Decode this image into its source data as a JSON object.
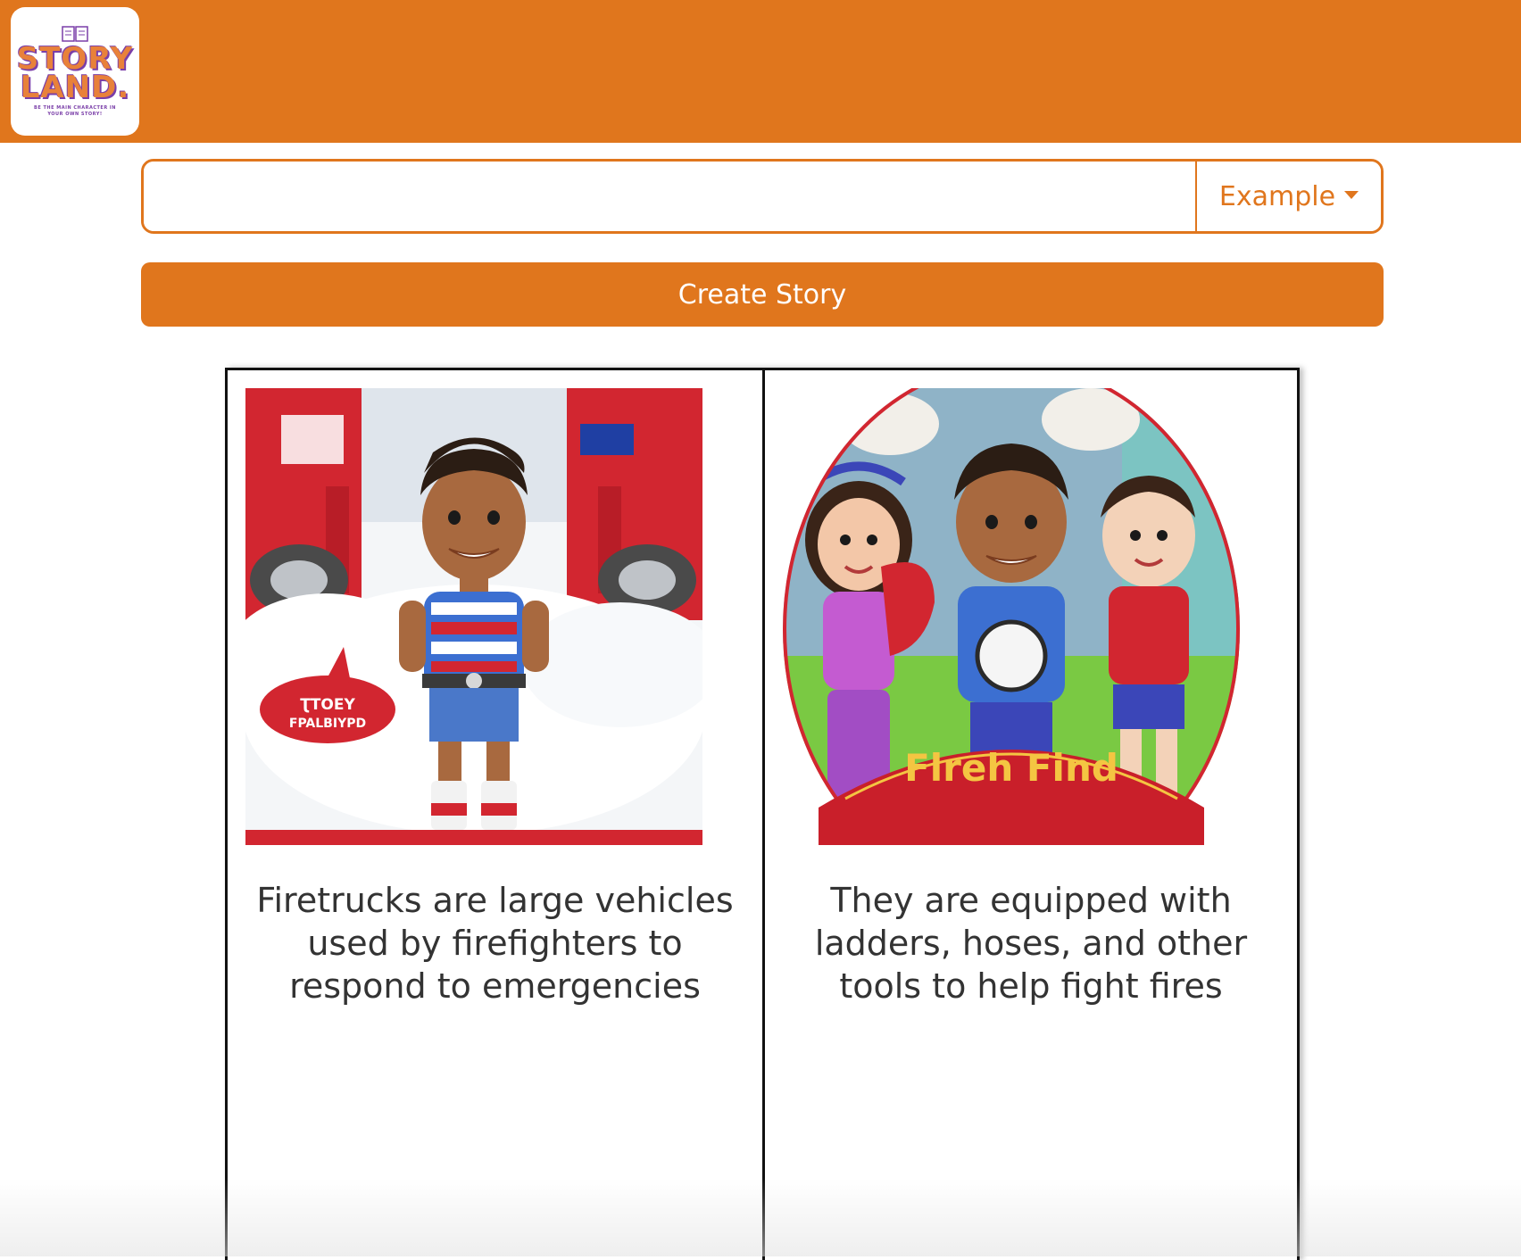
{
  "header": {
    "logo": {
      "line1": "STORY",
      "line2": "LAND.",
      "tagline": "BE THE MAIN CHARACTER IN YOUR OWN STORY!"
    }
  },
  "search": {
    "value": "",
    "placeholder": "",
    "example_label": "Example"
  },
  "create_button_label": "Create Story",
  "pages": [
    {
      "text": "Firetrucks are large vehicles used by firefighters to respond to emergencies",
      "image": {
        "bubble_text_1": "ƮTOEY",
        "bubble_text_2": "FPALBIYPD"
      }
    },
    {
      "text": "They are equipped with ladders, hoses, and other tools to help fight fires",
      "image": {
        "banner_text": "Flreh Find"
      }
    }
  ],
  "colors": {
    "accent": "#e0761d",
    "text": "#333333",
    "logo_purple": "#7a3ea8"
  }
}
